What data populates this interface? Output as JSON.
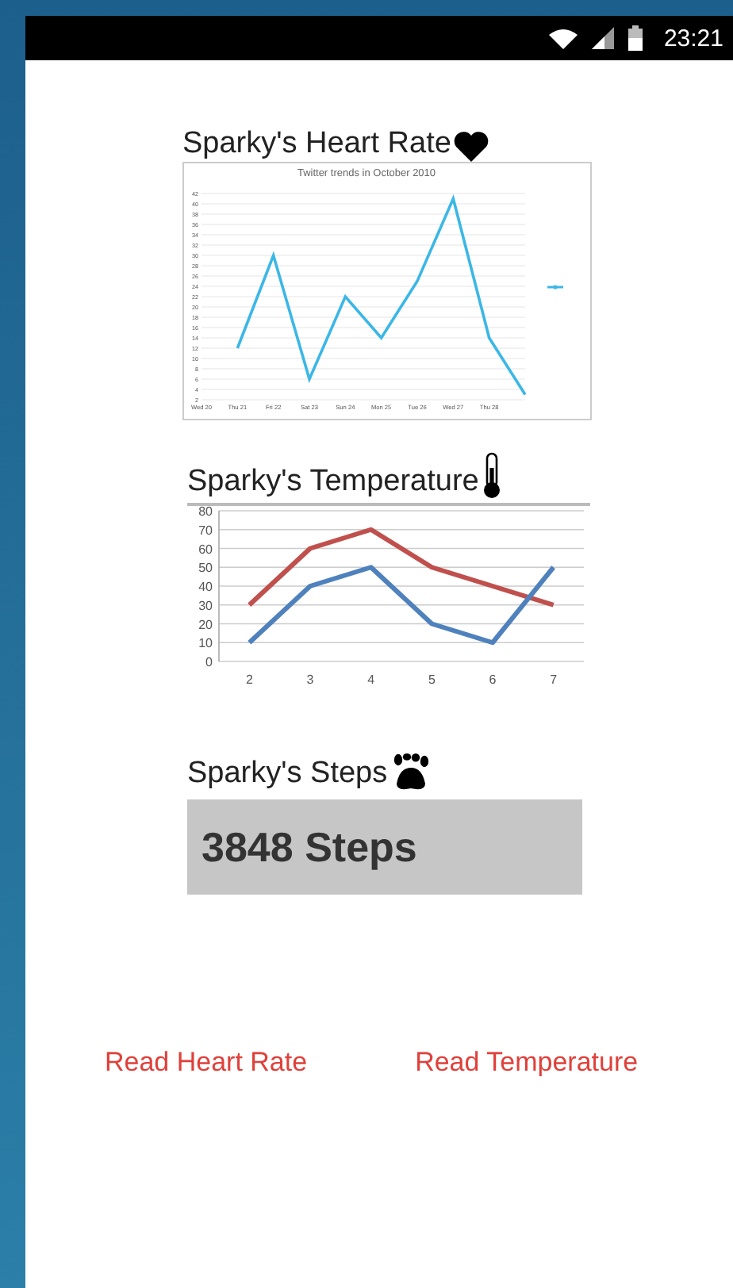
{
  "status_bar": {
    "time": "23:21"
  },
  "heart_rate": {
    "title": "Sparky's Heart Rate",
    "chart_data": {
      "type": "line",
      "title": "Twitter trends in October 2010",
      "grid": true,
      "ylim": [
        2,
        42
      ],
      "categories": [
        "Wed 20",
        "Thu 21",
        "Fri 22",
        "Sat 23",
        "Sun 24",
        "Mon 25",
        "Tue 26",
        "Wed 27",
        "Thu 28",
        null
      ],
      "yticks": [
        2,
        4,
        6,
        8,
        10,
        12,
        14,
        16,
        18,
        20,
        22,
        24,
        26,
        28,
        30,
        32,
        34,
        36,
        38,
        40,
        42
      ],
      "series": [
        {
          "color": "#3bb7e6",
          "values": [
            null,
            12,
            30,
            6,
            22,
            14,
            25,
            41,
            14,
            3
          ]
        }
      ]
    }
  },
  "temperature": {
    "title": "Sparky's Temperature",
    "chart_data": {
      "type": "line",
      "grid": true,
      "categories": [
        "2",
        "3",
        "4",
        "5",
        "6",
        "7"
      ],
      "ylim": [
        0,
        80
      ],
      "yticks": [
        0,
        10,
        20,
        30,
        40,
        50,
        60,
        70,
        80
      ],
      "series": [
        {
          "color": "#c0504d",
          "values": [
            30,
            60,
            70,
            50,
            40,
            30
          ]
        },
        {
          "color": "#4f81bd",
          "values": [
            10,
            40,
            50,
            20,
            10,
            50
          ]
        }
      ]
    }
  },
  "steps": {
    "title": "Sparky's Steps",
    "reading": "3848 Steps"
  },
  "buttons": [
    "Read Heart Rate",
    "Read Temperature"
  ]
}
